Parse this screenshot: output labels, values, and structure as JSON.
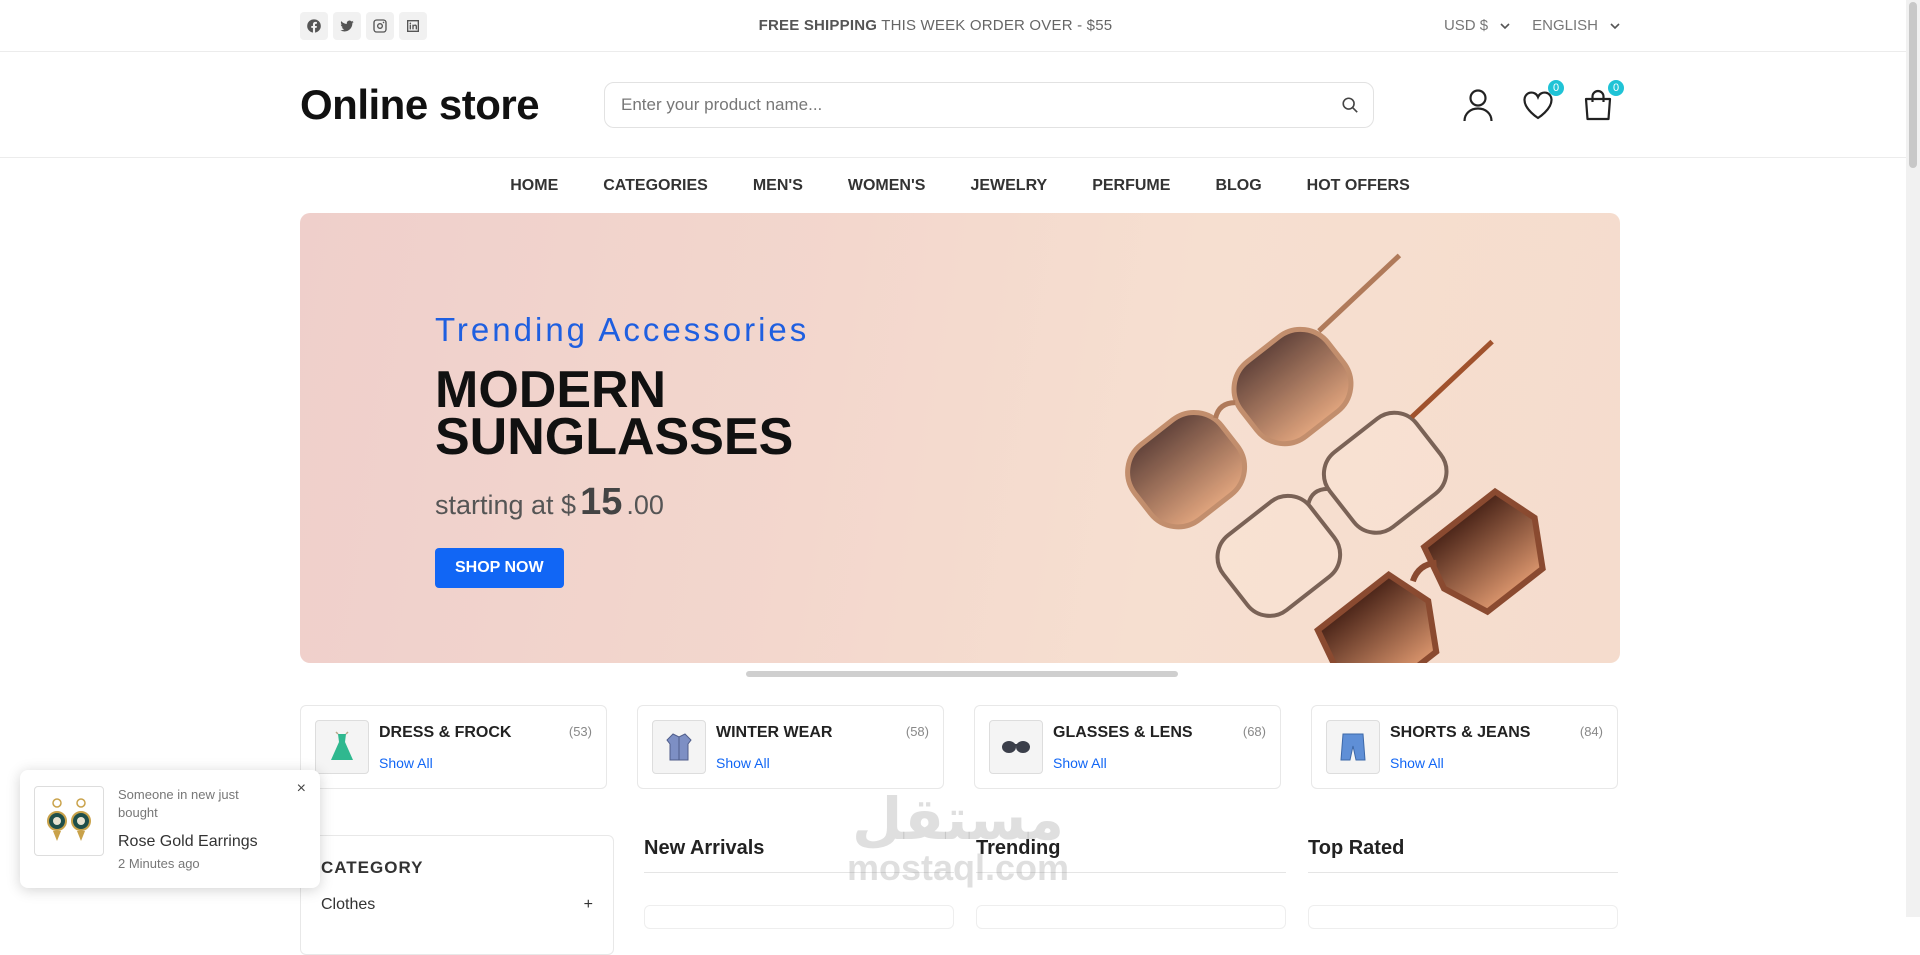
{
  "topbar": {
    "socials": [
      "facebook-icon",
      "twitter-icon",
      "instagram-icon",
      "linkedin-icon"
    ],
    "shipping_bold": "FREE SHIPPING",
    "shipping_rest": " THIS WEEK ORDER OVER - $55",
    "currency": "USD $",
    "language": "ENGLISH"
  },
  "header": {
    "logo": "Online store",
    "search_placeholder": "Enter your product name...",
    "wishlist_count": "0",
    "cart_count": "0"
  },
  "nav": [
    "HOME",
    "CATEGORIES",
    "MEN'S",
    "WOMEN'S",
    "JEWELRY",
    "PERFUME",
    "BLOG",
    "HOT OFFERS"
  ],
  "banner": {
    "subtitle": "Trending Accessories",
    "title": "MODERN SUNGLASSES",
    "price_prefix": "starting at $",
    "price_whole": "15",
    "price_cents": ".00",
    "cta": "SHOP NOW"
  },
  "categories": [
    {
      "name": "DRESS & FROCK",
      "count": "(53)",
      "link": "Show All",
      "icon": "dress-icon"
    },
    {
      "name": "WINTER WEAR",
      "count": "(58)",
      "link": "Show All",
      "icon": "coat-icon"
    },
    {
      "name": "GLASSES & LENS",
      "count": "(68)",
      "link": "Show All",
      "icon": "glasses-icon"
    },
    {
      "name": "SHORTS & JEANS",
      "count": "(84)",
      "link": "Show All",
      "icon": "shorts-icon"
    }
  ],
  "sidebar": {
    "title": "CATEGORY",
    "first_item": "Clothes",
    "first_item_toggle": "+"
  },
  "columns": [
    "New Arrivals",
    "Trending",
    "Top Rated"
  ],
  "toast": {
    "message": "Someone in new just bought",
    "product": "Rose Gold Earrings",
    "time": "2 Minutes ago",
    "close": "×"
  },
  "watermark": {
    "arabic": "مستقل",
    "latin": "mostaql.com"
  },
  "colors": {
    "accent": "#1166f5",
    "badge": "#20c3d6",
    "banner_bg": "#f3d7cd"
  }
}
